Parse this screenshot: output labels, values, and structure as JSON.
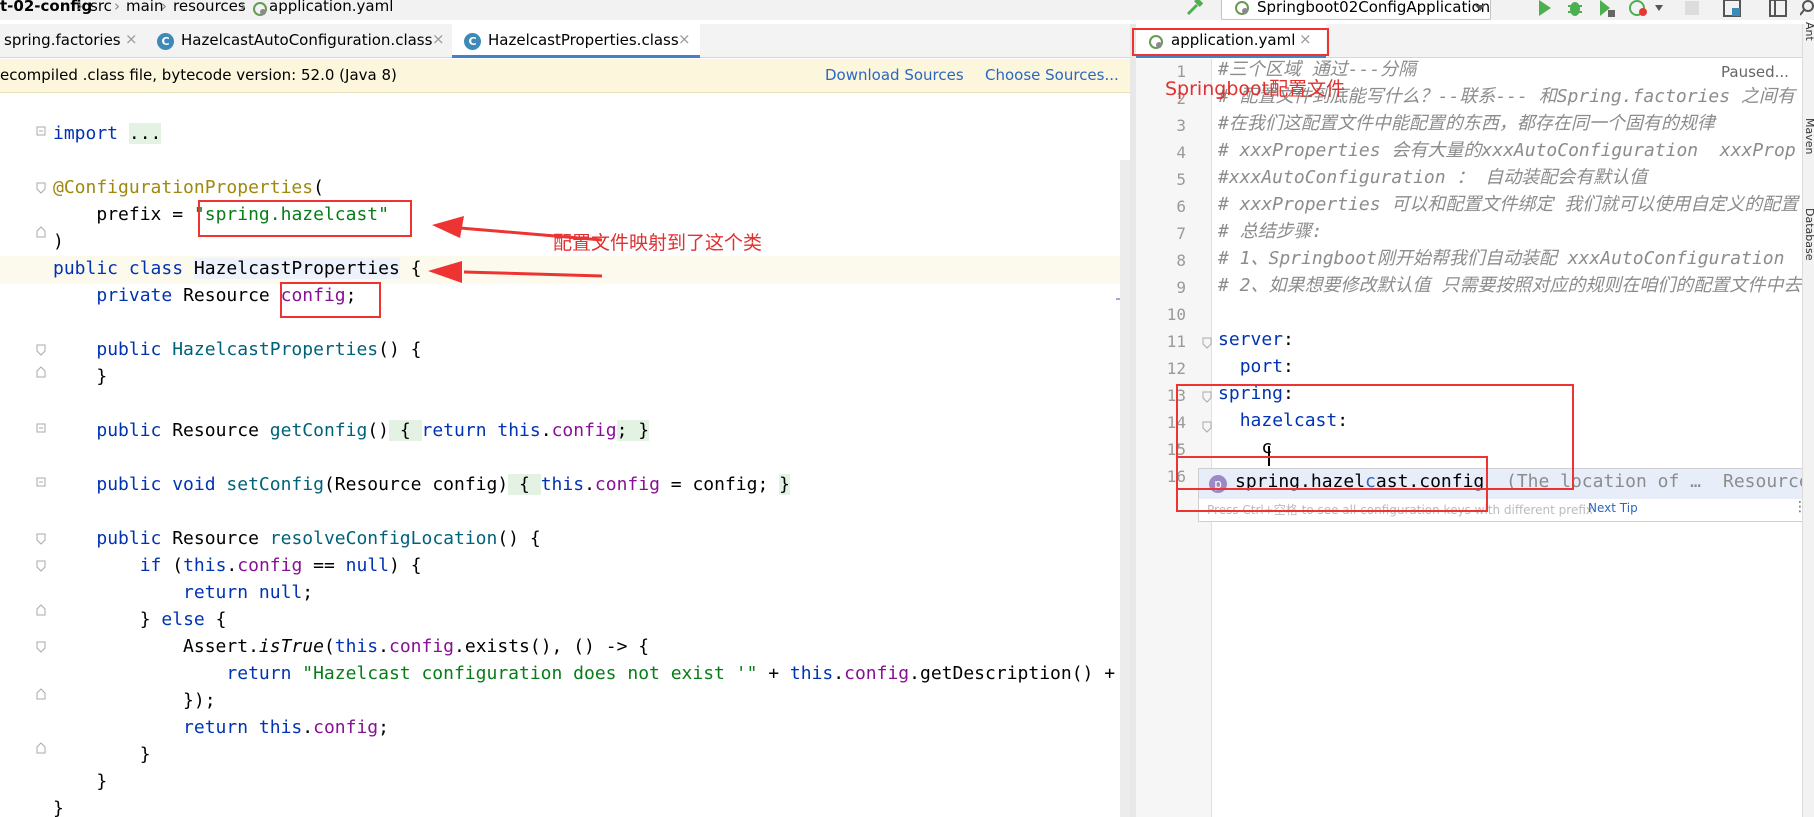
{
  "breadcrumb": [
    "t-02-config",
    "src",
    "main",
    "resources",
    "application.yaml"
  ],
  "toolbar": {
    "run_config": "Springboot02ConfigApplication"
  },
  "tabs_left": [
    {
      "label": "spring.factories",
      "active": false
    },
    {
      "label": "HazelcastAutoConfiguration.class",
      "active": false
    },
    {
      "label": "HazelcastProperties.class",
      "active": true
    }
  ],
  "tab_right": {
    "label": "application.yaml",
    "close": "×"
  },
  "banner": {
    "message": "ecompiled .class file, bytecode version: 52.0 (Java 8)",
    "download": "Download Sources",
    "choose": "Choose Sources..."
  },
  "paused": "Paused...",
  "annotations": {
    "mapping_note": "配置文件映射到了这个类",
    "yaml_title": "Springboot配置文件"
  },
  "java": {
    "import_kw": "import",
    "import_fold": "...",
    "annotation": "@ConfigurationProperties",
    "paren_open": "(",
    "prefix_key": "prefix = ",
    "prefix_val": "\"spring.hazelcast\"",
    "paren_close": ")",
    "class_kw": "public class ",
    "class_name": "HazelcastProperties",
    "brace_open": " {",
    "private_kw": "private ",
    "resource_type": "Resource ",
    "config_field": "config",
    "semicolon": ";",
    "ctor_kw": "public ",
    "ctor_name": "HazelcastProperties",
    "ctor_sig": "() {",
    "brace_close": "}",
    "get_public": "public ",
    "get_type": "Resource ",
    "get_name": "getConfig",
    "get_parens": "()",
    "get_body_open": " { ",
    "get_return": "return ",
    "get_this": "this",
    "get_dot": ".",
    "get_field": "config",
    "get_body_close": "; }",
    "set_public": "public void ",
    "set_name": "setConfig",
    "set_params": "(Resource config)",
    "set_body_open": " { ",
    "set_this": "this",
    "set_dot": ".",
    "set_field": "config",
    "set_assign": " = config; ",
    "set_close": "}",
    "res_public": "public ",
    "res_type": "Resource ",
    "res_name": "resolveConfigLocation",
    "res_sig": "() {",
    "if_kw": "if ",
    "if_open": "(",
    "if_this": "this",
    "if_dot": ".",
    "if_field": "config",
    "if_cmp": " == ",
    "if_null": "null",
    "if_close": ") {",
    "ret_kw": "return ",
    "ret_null": "null",
    "ret_semi": ";",
    "else_open": "} ",
    "else_kw": "else",
    "else_brace": " {",
    "assert_cls": "Assert.",
    "assert_m": "isTrue",
    "assert_open": "(",
    "assert_this": "this",
    "assert_dot": ".",
    "assert_field": "config",
    "assert_rest": ".exists(), () -> {",
    "ret2_kw": "return ",
    "ret2_str": "\"Hazelcast configuration does not exist '\"",
    "ret2_plus": " + ",
    "ret2_this": "this",
    "ret2_dot": ".",
    "ret2_field": "config",
    "ret2_rest": ".getDescription() +",
    "lambda_close": "});",
    "ret3_kw": "return ",
    "ret3_this": "this",
    "ret3_dot": ".",
    "ret3_field": "config",
    "ret3_semi": ";",
    "close_else": "}",
    "close_method": "}",
    "close_class": "}"
  },
  "yaml": {
    "line_numbers": [
      "1",
      "2",
      "3",
      "4",
      "5",
      "6",
      "7",
      "8",
      "9",
      "10",
      "11",
      "12",
      "13",
      "14",
      "15",
      "16"
    ],
    "l1": "#三个区域 通过---分隔",
    "l2": "# 配置文件到底能写什么？--联系--- 和Spring.factories 之间有",
    "l3": "#在我们这配置文件中能配置的东西，都存在同一个固有的规律",
    "l4": "# xxxProperties 会有大量的xxxAutoConfiguration  xxxProp",
    "l5": "#xxxAutoConfiguration ： 自动装配会有默认值",
    "l6": "# xxxProperties 可以和配置文件绑定 我们就可以使用自定义的配置",
    "l7": "# 总结步骤:",
    "l8": "# 1、Springboot刚开始帮我们自动装配 xxxAutoConfiguration",
    "l9": "# 2、如果想要修改默认值 只需要按照对应的规则在咱们的配置文件中去",
    "server": "server",
    "port": "port",
    "spring": "spring",
    "hazelcast": "hazelcast",
    "colon": ":",
    "typed": "c"
  },
  "completion": {
    "badge": "p",
    "pre": "spring.hazel",
    "match": "c",
    "post": "ast.config",
    "hint": "  (The location of …",
    "type": "Resource",
    "footer": "Press Ctrl+空格 to see all configuration keys with different prefix",
    "next_tip": "Next Tip"
  },
  "side_labels": {
    "ant": "Ant",
    "maven": "Maven",
    "database": "Database"
  }
}
